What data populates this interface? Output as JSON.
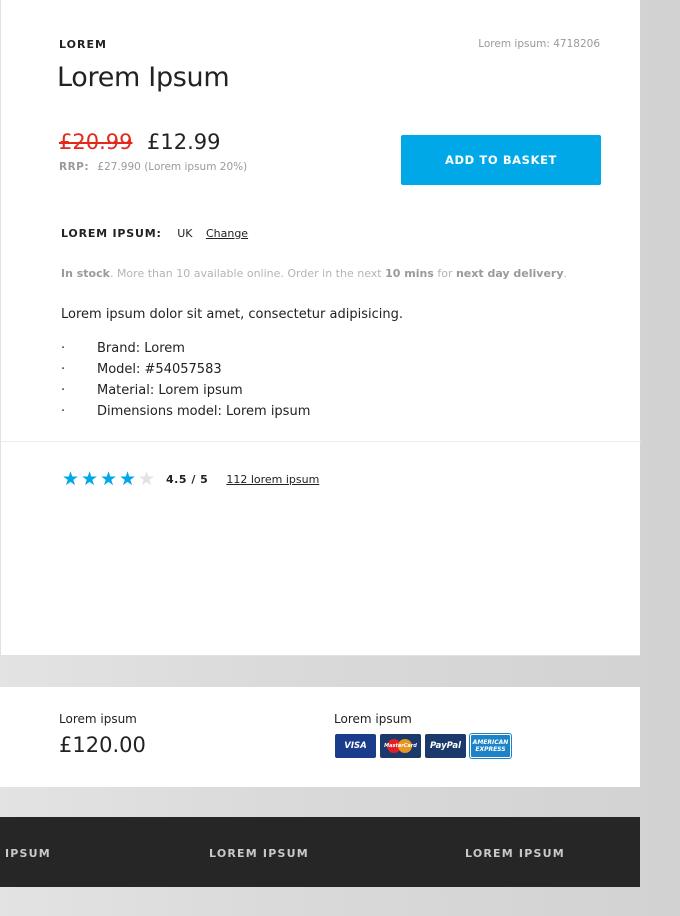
{
  "product": {
    "brand": "LOREM",
    "sku": "Lorem ipsum: 4718206",
    "title": "Lorem Ipsum",
    "price_old": "£20.99",
    "price_new": "£12.99",
    "rrp_label": "RRP:",
    "rrp_value": "£27.990",
    "rrp_note": "(Lorem ipsum 20%)",
    "add_to_basket": "ADD TO BASKET",
    "delivery_label": "LOREM IPSUM:",
    "delivery_country": "UK",
    "delivery_change": "Change",
    "stock": {
      "status": "In stock",
      "text1": ". More than 10 available online. Order in the next ",
      "time": "10 mins",
      "text2": " for ",
      "option": "next day delivery",
      "text3": "."
    },
    "description": "Lorem ipsum dolor sit amet, consectetur adipisicing.",
    "bullet": "·",
    "specs": [
      "Brand: Lorem",
      "Model: #54057583",
      "Material: Lorem ipsum",
      "Dimensions model: Lorem ipsum"
    ],
    "rating": {
      "value": 4.5,
      "max": 5,
      "stars": [
        "★",
        "★",
        "★",
        "★",
        "★"
      ],
      "score_text": "4.5 / 5",
      "reviews_link": "112 lorem ipsum",
      "accent_color": "#00a8e8"
    }
  },
  "summary": {
    "total_label": "Lorem ipsum",
    "total_value": "£120.00",
    "payment_label": "Lorem ipsum",
    "payment_methods": {
      "visa": "VISA",
      "mastercard": "MasterCard",
      "paypal": "PayPal",
      "amex_line1": "AMERICAN",
      "amex_line2": "EXPRESS"
    }
  },
  "footer": {
    "links": [
      "IPSUM",
      "LOREM IPSUM",
      "LOREM IPSUM"
    ]
  },
  "colors": {
    "accent": "#00a8e8",
    "sale_price": "#e3291c",
    "footer_bg": "#262626"
  }
}
